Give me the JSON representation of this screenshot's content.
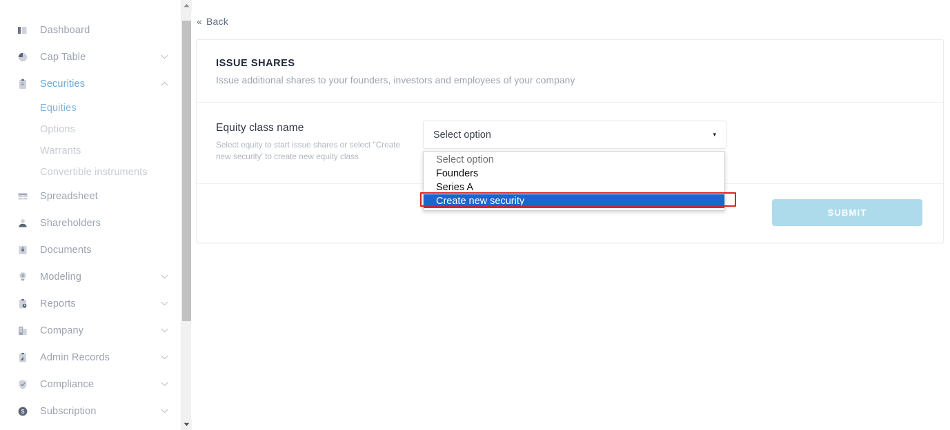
{
  "sidebar": {
    "items": [
      {
        "label": "Dashboard",
        "icon": "dashboard-icon",
        "expandable": false,
        "state": "default"
      },
      {
        "label": "Cap Table",
        "icon": "pie-chart-icon",
        "expandable": true,
        "chevron": "down",
        "state": "default"
      },
      {
        "label": "Securities",
        "icon": "clipboard-icon",
        "expandable": true,
        "chevron": "up",
        "state": "active"
      },
      {
        "label": "Spreadsheet",
        "icon": "grid-icon",
        "expandable": false,
        "state": "default"
      },
      {
        "label": "Shareholders",
        "icon": "user-icon",
        "expandable": false,
        "state": "default"
      },
      {
        "label": "Documents",
        "icon": "document-lock-icon",
        "expandable": false,
        "state": "default"
      },
      {
        "label": "Modeling",
        "icon": "lightbulb-dollar-icon",
        "expandable": true,
        "chevron": "down",
        "state": "default"
      },
      {
        "label": "Reports",
        "icon": "clipboard-clock-icon",
        "expandable": true,
        "chevron": "down",
        "state": "default"
      },
      {
        "label": "Company",
        "icon": "building-icon",
        "expandable": true,
        "chevron": "down",
        "state": "default"
      },
      {
        "label": "Admin Records",
        "icon": "clipboard-arrow-icon",
        "expandable": true,
        "chevron": "down",
        "state": "default"
      },
      {
        "label": "Compliance",
        "icon": "shield-check-icon",
        "expandable": true,
        "chevron": "down",
        "state": "default"
      },
      {
        "label": "Subscription",
        "icon": "dollar-circle-icon",
        "expandable": true,
        "chevron": "down",
        "state": "default"
      }
    ],
    "securities_subitems": [
      {
        "label": "Equities",
        "state": "active"
      },
      {
        "label": "Options",
        "state": "default"
      },
      {
        "label": "Warrants",
        "state": "default"
      },
      {
        "label": "Convertible instruments",
        "state": "default"
      }
    ]
  },
  "main": {
    "back_label": "Back",
    "back_chevrons": "«",
    "card_title": "ISSUE SHARES",
    "card_subtitle": "Issue additional shares to your founders, investors and employees of your company",
    "form": {
      "label": "Equity class name",
      "hint": "Select equity to start issue shares or select \"Create new security' to create new equity class",
      "select": {
        "value": "Select option",
        "caret": "▾",
        "open": true,
        "options": [
          {
            "label": "Select option",
            "state": "placeholder"
          },
          {
            "label": "Founders",
            "state": "default"
          },
          {
            "label": "Series A",
            "state": "default"
          },
          {
            "label": "Create new security",
            "state": "selected"
          }
        ]
      }
    },
    "submit_label": "SUBMIT"
  },
  "colors": {
    "accent_blue": "#69a8d8",
    "submit_disabled": "#aedbeb",
    "dropdown_selected": "#1a66cc",
    "highlight_box": "#e02020",
    "sidebar_text": "#9aa3b0",
    "sidebar_sub_text": "#c6ccd4",
    "title_text": "#202a3c"
  }
}
